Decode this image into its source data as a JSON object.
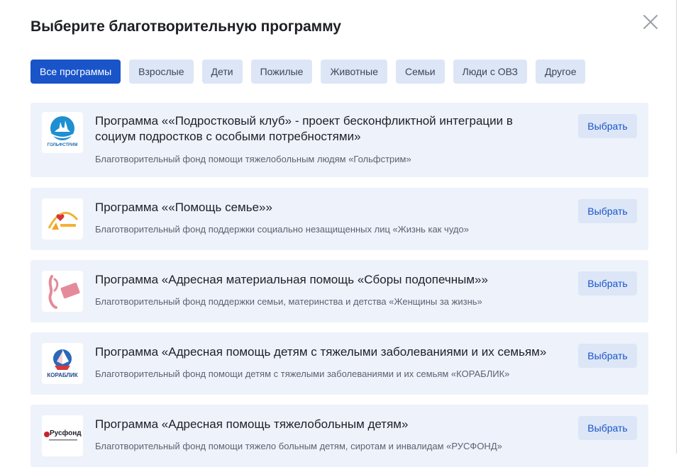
{
  "modal": {
    "title": "Выберите благотворительную программу",
    "close_icon": "close-icon"
  },
  "filters": [
    {
      "label": "Все программы",
      "active": true
    },
    {
      "label": "Взрослые",
      "active": false
    },
    {
      "label": "Дети",
      "active": false
    },
    {
      "label": "Пожилые",
      "active": false
    },
    {
      "label": "Животные",
      "active": false
    },
    {
      "label": "Семьи",
      "active": false
    },
    {
      "label": "Люди с ОВЗ",
      "active": false
    },
    {
      "label": "Другое",
      "active": false
    }
  ],
  "programs": [
    {
      "title": "Программа ««Подростковый клуб» - проект бесконфликтной интеграции в социум подростков с особыми потребностями»",
      "org": "Благотворительный фонд помощи тяжелобольным людям «Гольфстрим»",
      "logo_icon": "golfstrim-logo",
      "logo_text": "ГОЛЬФСТРИМ",
      "button": "Выбрать"
    },
    {
      "title": "Программа ««Помощь семье»»",
      "org": "Благотворительный фонд поддержки социально незащищенных лиц «Жизнь как чудо»",
      "logo_icon": "zhizn-kak-chudo-logo",
      "logo_text": "",
      "button": "Выбрать"
    },
    {
      "title": "Программа «Адресная материальная помощь «Сборы подопечным»»",
      "org": "Благотворительный фонд поддержки семьи, материнства и детства «Женщины за жизнь»",
      "logo_icon": "zhenshchiny-za-zhizn-logo",
      "logo_text": "",
      "button": "Выбрать"
    },
    {
      "title": "Программа «Адресная помощь детям с тяжелыми заболеваниями и их семьям»",
      "org": "Благотворительный фонд помощи детям с тяжелыми заболеваниями и их семьям «КОРАБЛИК»",
      "logo_icon": "korablik-logo",
      "logo_text": "КОРАБЛИК",
      "button": "Выбрать"
    },
    {
      "title": "Программа «Адресная помощь тяжелобольным детям»",
      "org": "Благотворительный фонд помощи тяжело больным детям, сиротам и инвалидам «РУСФОНД»",
      "logo_icon": "rusfond-logo",
      "logo_text": "Русфонд",
      "button": "Выбрать"
    }
  ],
  "colors": {
    "accent": "#1954c9",
    "chip_bg": "#dde6f6",
    "card_bg": "#eef2fb"
  }
}
